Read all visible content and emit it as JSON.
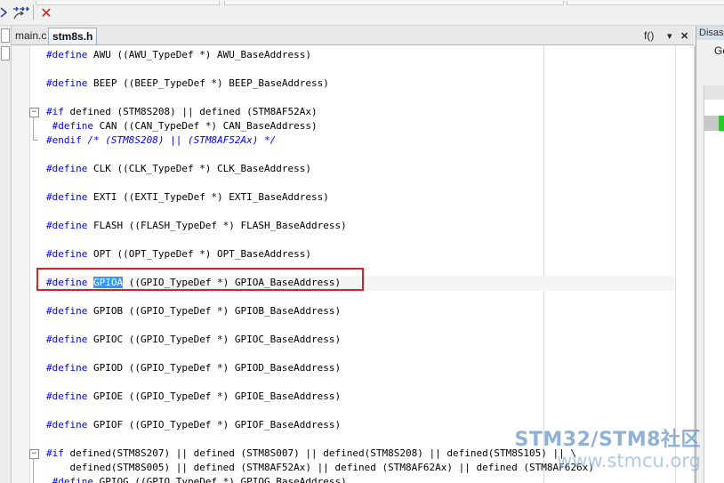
{
  "toolbar": {
    "icons": [
      "step-arrows-icon",
      "step-arrows-down-icon",
      "close-red-x-icon"
    ],
    "close_glyph": "✕",
    "arrows_glyph": "↦↦",
    "arrows2_glyph": "⇉"
  },
  "tabs": [
    {
      "label": "main.c",
      "active": false
    },
    {
      "label": "stm8s.h",
      "active": true
    }
  ],
  "tabbar_right": {
    "func_label": "f()",
    "dropdown_glyph": "▾",
    "close_glyph": "✕"
  },
  "right_panel": {
    "title": "Disass",
    "go_label": "Go"
  },
  "code": {
    "l01_a": "#define",
    "l01_b": " AWU ((AWU_TypeDef *) AWU_BaseAddress)",
    "l02_a": "#define",
    "l02_b": " BEEP ((BEEP_TypeDef *) BEEP_BaseAddress)",
    "l03_a": "#if",
    "l03_b": " defined (STM8S208) || defined (STM8AF52Ax)",
    "l04_a": " #define",
    "l04_b": " CAN ((CAN_TypeDef *) CAN_BaseAddress)",
    "l05_a": "#endif",
    "l05_b": " /* (STM8S208) || (STM8AF52Ax) */",
    "l06_a": "#define",
    "l06_b": " CLK ((CLK_TypeDef *) CLK_BaseAddress)",
    "l07_a": "#define",
    "l07_b": " EXTI ((EXTI_TypeDef *) EXTI_BaseAddress)",
    "l08_a": "#define",
    "l08_b": " FLASH ((FLASH_TypeDef *) FLASH_BaseAddress)",
    "l09_a": "#define",
    "l09_b": " OPT ((OPT_TypeDef *) OPT_BaseAddress)",
    "l10_a": "#define",
    "l10_sp": " ",
    "l10_hl": "GPIOA",
    "l10_b": " ((GPIO_TypeDef *) GPIOA_BaseAddress)",
    "l11_a": "#define",
    "l11_b": " GPIOB ((GPIO_TypeDef *) GPIOB_BaseAddress)",
    "l12_a": "#define",
    "l12_b": " GPIOC ((GPIO_TypeDef *) GPIOC_BaseAddress)",
    "l13_a": "#define",
    "l13_b": " GPIOD ((GPIO_TypeDef *) GPIOD_BaseAddress)",
    "l14_a": "#define",
    "l14_b": " GPIOE ((GPIO_TypeDef *) GPIOE_BaseAddress)",
    "l15_a": "#define",
    "l15_b": " GPIOF ((GPIO_TypeDef *) GPIOF_BaseAddress)",
    "l16_a": "#if",
    "l16_b": " defined(STM8S207) || defined (STM8S007) || defined(STM8S208) || defined(STM8S105) || \\",
    "l17_b": "    defined(STM8S005) || defined (STM8AF52Ax) || defined (STM8AF62Ax) || defined (STM8AF626x)",
    "l18_a": " #define",
    "l18_b": " GPIOG ((GPIO_TypeDef *) GPIOG_BaseAddress)"
  },
  "watermark": {
    "line1": "STM32/STM8社区",
    "line2": "www.stmcu.org"
  },
  "colors": {
    "keyword": "#0000ff",
    "selection": "#3399ff",
    "annotation_box": "#e02020"
  }
}
